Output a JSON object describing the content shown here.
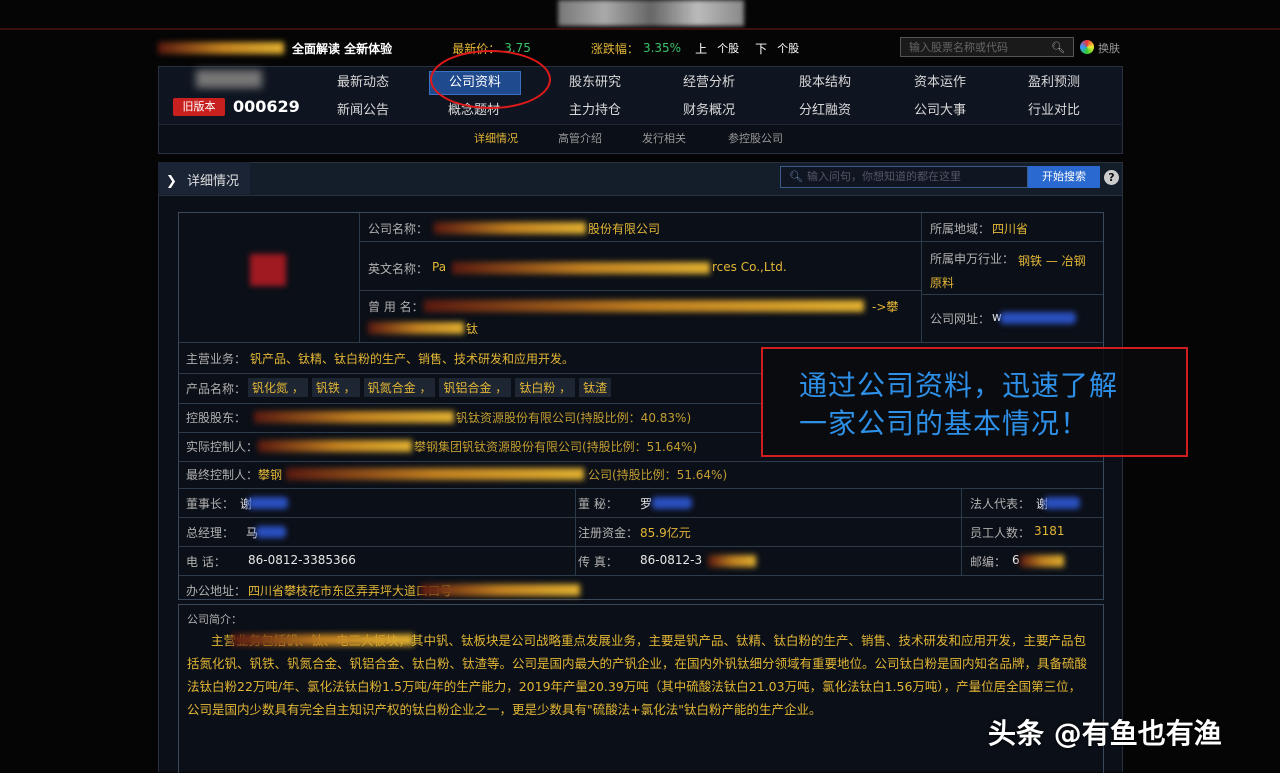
{
  "ticker": {
    "promo": "全面解读 全新体验",
    "price_label": "最新价：",
    "price": "3.75",
    "change_label": "涨跌幅：",
    "change": "3.35%",
    "up_label": "上",
    "up_unit": "个股",
    "down_label": "下",
    "down_unit": "个股",
    "search_placeholder": "输入股票名称或代码",
    "exit_label": "换肤"
  },
  "stock": {
    "tag": "旧版本",
    "code": "000629"
  },
  "nav": {
    "row1": [
      "最新动态",
      "公司资料",
      "股东研究",
      "经营分析",
      "股本结构",
      "资本运作",
      "盈利预测"
    ],
    "row2": [
      "新闻公告",
      "概念题材",
      "主力持仓",
      "财务概况",
      "分红融资",
      "公司大事",
      "行业对比"
    ],
    "active": "公司资料",
    "sub": [
      "详细情况",
      "高管介绍",
      "发行相关",
      "参控股公司"
    ],
    "sub_active": "详细情况"
  },
  "section": {
    "title": "详细情况",
    "search_placeholder": "输入问句，你想知道的都在这里",
    "search_button": "开始搜索",
    "help": "?"
  },
  "info": {
    "company_name_label": "公司名称：",
    "company_name": "股份有限公司",
    "english_name_label": "英文名称：",
    "english_name_prefix": "Pa",
    "english_name_suffix": "rces Co.,Ltd.",
    "former_name_label": "曾 用 名：",
    "former_name_tail": "钛",
    "former_name_arrow": "->攀",
    "region_label": "所属地域：",
    "region": "四川省",
    "industry_label": "所属申万行业：",
    "industry": "钢铁 — 冶钢原料",
    "website_label": "公司网址：",
    "website": "w",
    "main_business_label": "主营业务：",
    "main_business": "钒产品、钛精、钛白粉的生产、销售、技术研发和应用开发。",
    "products_label": "产品名称：",
    "products": [
      "钒化氮",
      "钒铁",
      "钒氮合金",
      "钒铝合金",
      "钛白粉",
      "钛渣"
    ],
    "controller_label": "控股股东：",
    "controller": "钒钛资源股份有限公司(持股比例：40.83%)",
    "actual_controller_label": "实际控制人：",
    "actual_controller": "攀钢集团钒钛资源股份有限公司(持股比例：51.64%)",
    "final_controller_label": "最终控制人：",
    "final_controller_prefix": "攀钢",
    "final_controller": "公司(持股比例：51.64%)",
    "chairman_label": "董事长：",
    "chairman": "谢",
    "secretary_label": "董    秘：",
    "secretary": "罗",
    "legal_rep_label": "法人代表：",
    "legal_rep": "谢",
    "gm_label": "总经理：",
    "gm": "马",
    "capital_label": "注册资金：",
    "capital": "85.9亿元",
    "employees_label": "员工人数：",
    "employees": "3181",
    "phone_label": "电    话：",
    "phone": "86-0812-3385366",
    "fax_label": "传    真：",
    "fax": "86-0812-3",
    "zip_label": "邮编：",
    "zip": "6",
    "address_label": "办公地址：",
    "address": "四川省攀枝花市东区弄弄坪大道口口号"
  },
  "overlay": {
    "line1": "通过公司资料，迅速了解",
    "line2": "一家公司的基本情况！"
  },
  "intro": {
    "label": "公司简介：",
    "text": "主营业务包括钒、钛、电三大板块，其中钒、钛板块是公司战略重点发展业务，主要是钒产品、钛精、钛白粉的生产、销售、技术研发和应用开发，主要产品包括氮化钒、钒铁、钒氮合金、钒铝合金、钛白粉、钛渣等。公司是国内最大的产钒企业，在国内外钒钛细分领域有重要地位。公司钛白粉是国内知名品牌，具备硫酸法钛白粉22万吨/年、氯化法钛白粉1.5万吨/年的生产能力，2019年产量20.39万吨（其中硫酸法钛白21.03万吨，氯化法钛白1.56万吨），产量位居全国第三位，公司是国内少数具有完全自主知识产权的钛白粉企业之一，更是少数具有\"硫酸法+氯化法\"钛白粉产能的生产企业。"
  },
  "watermark": "头条 @有鱼也有渔"
}
